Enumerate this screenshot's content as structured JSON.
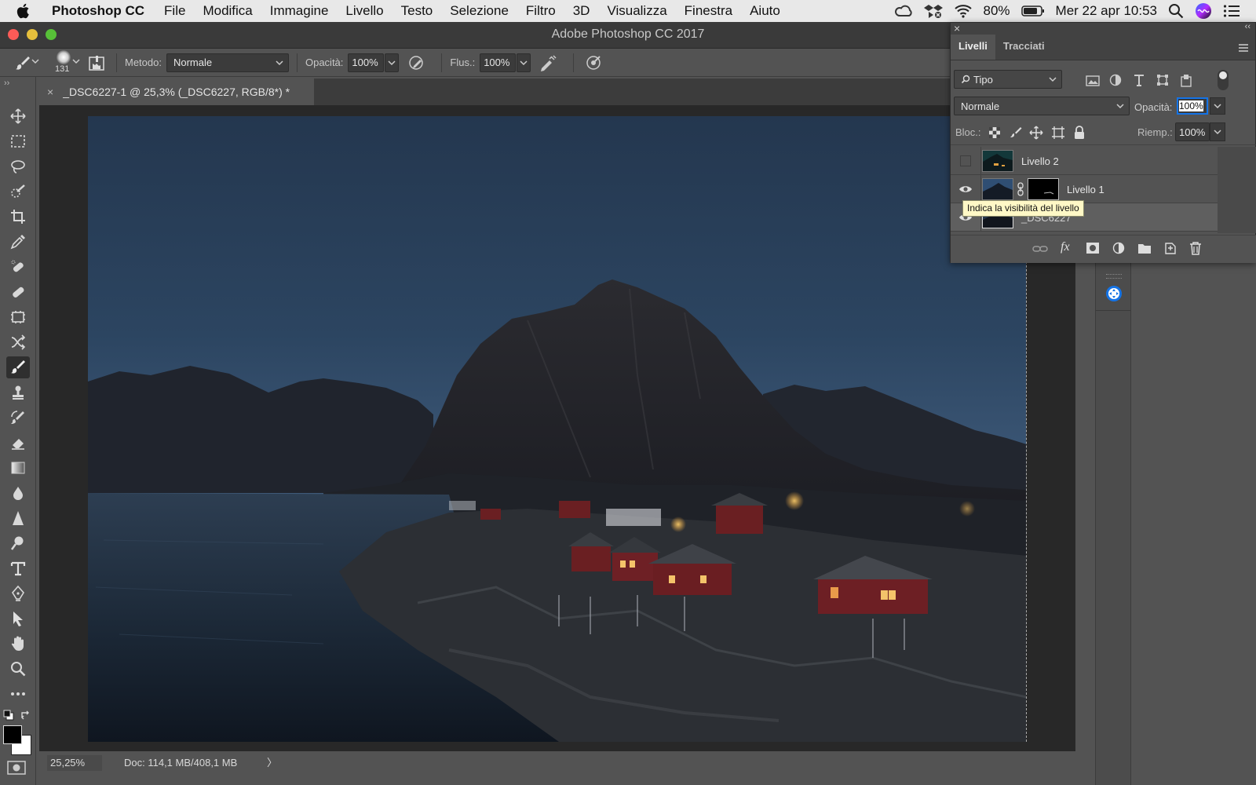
{
  "menubar": {
    "app_name": "Photoshop CC",
    "items": [
      "File",
      "Modifica",
      "Immagine",
      "Livello",
      "Testo",
      "Selezione",
      "Filtro",
      "3D",
      "Visualizza",
      "Finestra",
      "Aiuto"
    ],
    "battery": "80%",
    "datetime": "Mer 22 apr  10:53"
  },
  "window": {
    "title": "Adobe Photoshop CC 2017"
  },
  "options_bar": {
    "brush_size": "131",
    "mode_label": "Metodo:",
    "mode_value": "Normale",
    "opacity_label": "Opacità:",
    "opacity_value": "100%",
    "flow_label": "Flus.:",
    "flow_value": "100%"
  },
  "document": {
    "tab_title": "_DSC6227-1 @ 25,3% (_DSC6227, RGB/8*) *",
    "close_glyph": "×"
  },
  "status": {
    "zoom": "25,25%",
    "doc_size": "Doc: 114,1 MB/408,1 MB",
    "arrow": "〉"
  },
  "layers_panel": {
    "close_glyph": "×",
    "collapse_glyph": "‹‹",
    "tabs": [
      "Livelli",
      "Tracciati"
    ],
    "filter_value": "Tipo",
    "blend_value": "Normale",
    "opacity_label": "Opacità:",
    "opacity_value": "100%",
    "lock_label": "Bloc.:",
    "fill_label": "Riemp.:",
    "fill_value": "100%",
    "layers": [
      {
        "name": "Livello 2",
        "visible": false
      },
      {
        "name": "Livello 1",
        "visible": true
      },
      {
        "name": "_DSC6227",
        "visible": true
      }
    ],
    "tooltip": "Indica la visibilità del livello"
  },
  "colors": {
    "panel_bg": "#535353",
    "canvas_bg": "#282828",
    "accent_blue": "#1473e6",
    "tooltip_bg": "#fff8c6"
  }
}
